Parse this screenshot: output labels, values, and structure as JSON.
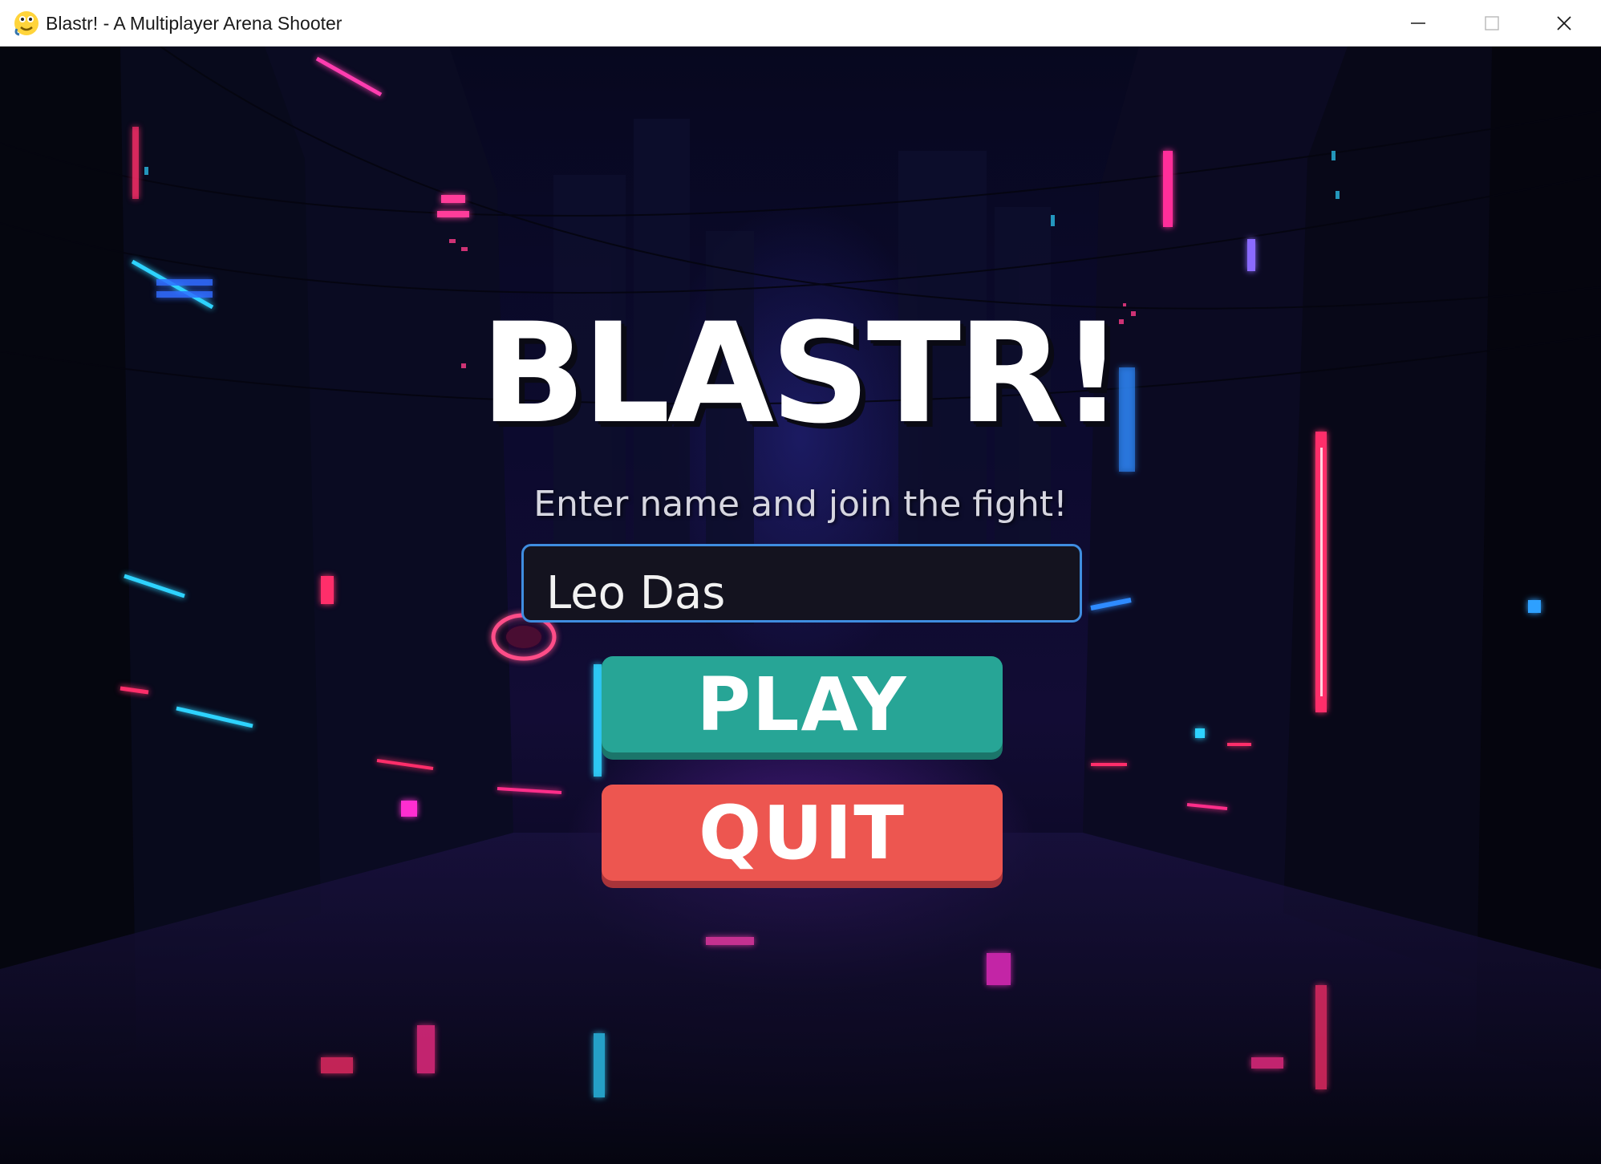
{
  "window": {
    "title": "Blastr! - A Multiplayer Arena Shooter",
    "app_icon": "python-snake-icon",
    "controls": [
      "minimize-icon",
      "maximize-icon",
      "close-icon"
    ]
  },
  "menu": {
    "title": "BLASTR!",
    "subtitle": "Enter name and join the fight!",
    "name_input_value": "Leo Das",
    "play_label": "PLAY",
    "quit_label": "QUIT"
  },
  "colors": {
    "play_button": "#27a596",
    "quit_button": "#ed5650",
    "input_border": "#3f8de0",
    "neon_pink": "#ff2d8a",
    "neon_cyan": "#2fd3ff"
  }
}
